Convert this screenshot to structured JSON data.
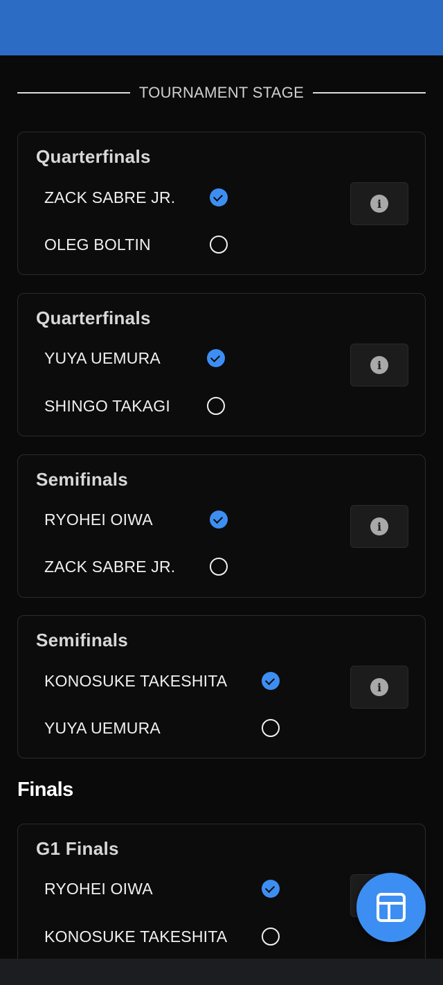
{
  "header": {
    "title": "TOURNAMENT STAGE"
  },
  "matches": [
    {
      "stage": "Quarterfinals",
      "wrestlers": [
        {
          "name": "ZACK SABRE JR.",
          "selected": true
        },
        {
          "name": "OLEG BOLTIN",
          "selected": false
        }
      ]
    },
    {
      "stage": "Quarterfinals",
      "wrestlers": [
        {
          "name": "YUYA UEMURA",
          "selected": true
        },
        {
          "name": "SHINGO TAKAGI",
          "selected": false
        }
      ]
    },
    {
      "stage": "Semifinals",
      "wrestlers": [
        {
          "name": "RYOHEI OIWA",
          "selected": true
        },
        {
          "name": "ZACK SABRE JR.",
          "selected": false
        }
      ]
    },
    {
      "stage": "Semifinals",
      "wrestlers": [
        {
          "name": "KONOSUKE TAKESHITA",
          "selected": true
        },
        {
          "name": "YUYA UEMURA",
          "selected": false
        }
      ]
    }
  ],
  "finals_section": {
    "title": "Finals",
    "match": {
      "stage": "G1 Finals",
      "wrestlers": [
        {
          "name": "RYOHEI OIWA",
          "selected": true
        },
        {
          "name": "KONOSUKE TAKESHITA",
          "selected": false
        }
      ]
    }
  },
  "icons": {
    "info": "info-icon",
    "selected": "check-circle-icon",
    "unselected": "empty-circle-icon",
    "fab": "table-grid-icon"
  },
  "info_glyph": "i",
  "colors": {
    "topbar": "#2d6cc4",
    "accent": "#3d8ef2",
    "background": "#0a0a0a"
  }
}
